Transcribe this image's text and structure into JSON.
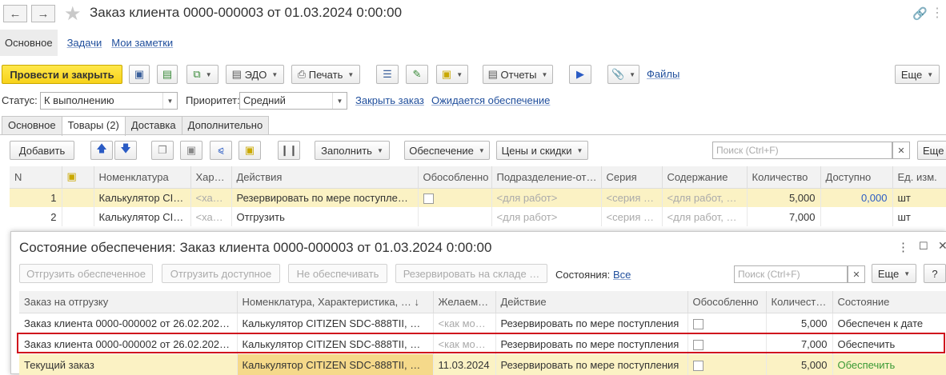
{
  "window": {
    "title": "Заказ клиента 0000-000003 от 01.03.2024 0:00:00",
    "back_icon": "arrow-left-icon",
    "forward_icon": "arrow-right-icon",
    "star_icon": "star-icon",
    "link_icon": "link-icon",
    "more_icon": "more-vertical-icon"
  },
  "subnav": [
    "Основное",
    "Задачи",
    "Мои заметки"
  ],
  "toolbar": {
    "post_close": "Провести и закрыть",
    "edo": "ЭДО",
    "print": "Печать",
    "reports": "Отчеты",
    "files": "Файлы",
    "more": "Еще"
  },
  "status": {
    "status_label": "Статус:",
    "status_value": "К выполнению",
    "priority_label": "Приоритет:",
    "priority_value": "Средний",
    "close_link": "Закрыть заказ",
    "supply_link": "Ожидается обеспечение"
  },
  "tabs": [
    "Основное",
    "Товары (2)",
    "Доставка",
    "Дополнительно"
  ],
  "goods_toolbar": {
    "add": "Добавить",
    "fill": "Заполнить",
    "supply": "Обеспечение",
    "prices": "Цены и скидки",
    "search_placeholder": "Поиск (Ctrl+F)",
    "more": "Еще"
  },
  "goods_table": {
    "columns": [
      "N",
      "",
      "Номенклатура",
      "Хар…",
      "Действия",
      "Обособленно",
      "Подразделение-от…",
      "Серия",
      "Содержание",
      "Количество",
      "Доступно",
      "Ед. изм."
    ],
    "rows": [
      {
        "n": "1",
        "item": "Калькулятор CI…",
        "char": "<ха…",
        "action": "Резервировать по мере поступления",
        "dept": "<для работ>",
        "series": "<серия …",
        "content": "<для работ, …",
        "qty": "5,000",
        "avail": "0,000",
        "unit": "шт"
      },
      {
        "n": "2",
        "item": "Калькулятор CI…",
        "char": "<ха…",
        "action": "Отгрузить",
        "dept": "<для работ>",
        "series": "<серия …",
        "content": "<для работ, …",
        "qty": "7,000",
        "avail": "",
        "unit": "шт"
      }
    ]
  },
  "supply_window": {
    "title": "Состояние обеспечения: Заказ клиента 0000-000003 от 01.03.2024 0:00:00",
    "btn_ship_provided": "Отгрузить обеспеченное",
    "btn_ship_available": "Отгрузить доступное",
    "btn_no_supply": "Не обеспечивать",
    "btn_reserve": "Резервировать на складе …",
    "states_label": "Состояния:",
    "states_link": "Все",
    "search_placeholder": "Поиск (Ctrl+F)",
    "more": "Еще",
    "help": "?",
    "columns": [
      "Заказ на отгрузку",
      "Номенклатура, Характеристика, …",
      "Желаем…",
      "Действие",
      "Обособленно",
      "Количест…",
      "Состояние"
    ],
    "rows": [
      {
        "order": "Заказ клиента 0000-000002 от 26.02.2024…",
        "item": "Калькулятор CITIZEN SDC-888TII, ш…",
        "date": "<как мо…",
        "action": "Резервировать по мере поступления",
        "qty": "5,000",
        "state": "Обеспечен к дате"
      },
      {
        "order": "Заказ клиента 0000-000002 от 26.02.2024…",
        "item": "Калькулятор CITIZEN SDC-888TII, ш…",
        "date": "<как мо…",
        "action": "Резервировать по мере поступления",
        "qty": "7,000",
        "state": "Обеспечить"
      },
      {
        "order": "Текущий заказ",
        "item": "Калькулятор CITIZEN SDC-888TII, ш…",
        "date": "11.03.2024",
        "action": "Резервировать по мере поступления",
        "qty": "5,000",
        "state": "Обеспечить"
      }
    ]
  }
}
